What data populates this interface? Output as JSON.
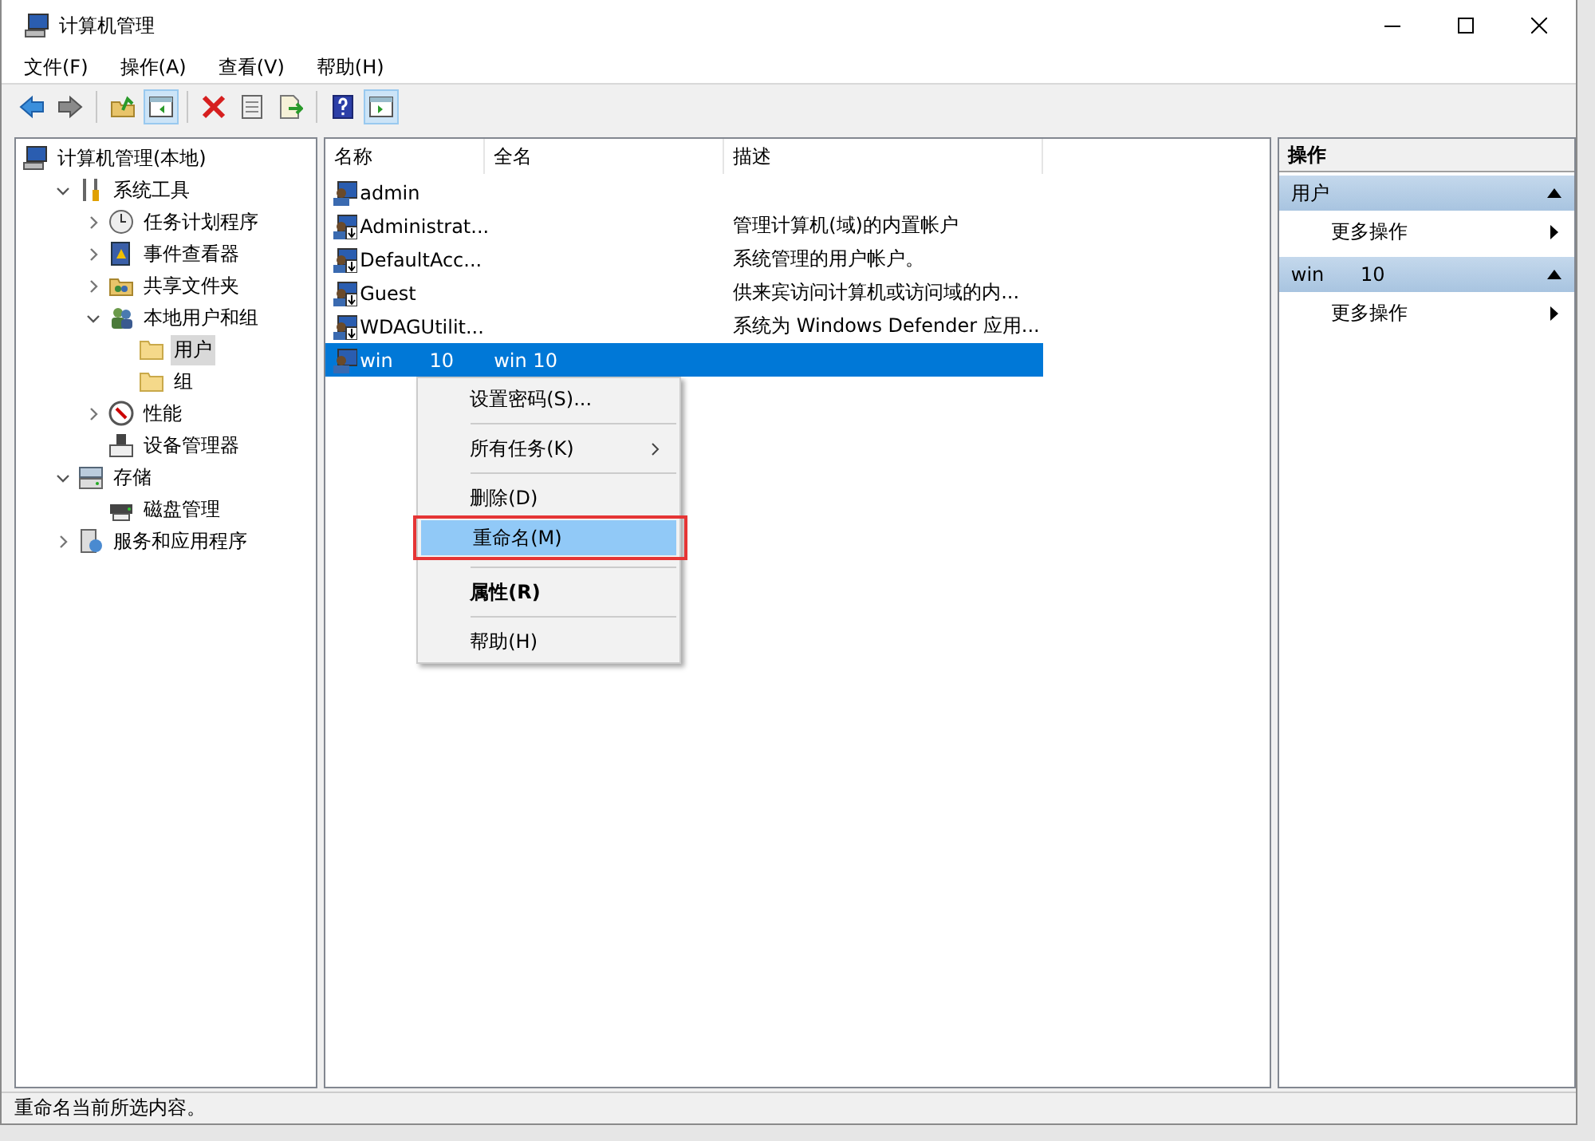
{
  "window": {
    "title": "计算机管理"
  },
  "menu_bar": [
    "文件(F)",
    "操作(A)",
    "查看(V)",
    "帮助(H)"
  ],
  "toolbar": [
    {
      "kind": "back",
      "pressed": false
    },
    {
      "kind": "forward",
      "pressed": false
    },
    {
      "kind": "sep"
    },
    {
      "kind": "up",
      "pressed": false
    },
    {
      "kind": "tree",
      "pressed": true
    },
    {
      "kind": "sep"
    },
    {
      "kind": "delete",
      "pressed": false
    },
    {
      "kind": "properties",
      "pressed": false
    },
    {
      "kind": "export",
      "pressed": false
    },
    {
      "kind": "sep"
    },
    {
      "kind": "help",
      "pressed": false
    },
    {
      "kind": "actionpane",
      "pressed": true
    }
  ],
  "tree": [
    {
      "label": "计算机管理(本地)",
      "kind": "computer",
      "selected": false,
      "children": [
        {
          "label": "系统工具",
          "kind": "tools",
          "expanded": true,
          "selected": false,
          "children": [
            {
              "label": "任务计划程序",
              "kind": "clock",
              "expanded": false,
              "selected": false
            },
            {
              "label": "事件查看器",
              "kind": "event",
              "expanded": false,
              "selected": false
            },
            {
              "label": "共享文件夹",
              "kind": "share",
              "expanded": false,
              "selected": false
            },
            {
              "label": "本地用户和组",
              "kind": "users",
              "expanded": true,
              "selected": false,
              "children": [
                {
                  "label": "用户",
                  "kind": "folder",
                  "selected": true
                },
                {
                  "label": "组",
                  "kind": "folder",
                  "selected": false
                }
              ]
            },
            {
              "label": "性能",
              "kind": "perf",
              "expanded": false,
              "selected": false
            },
            {
              "label": "设备管理器",
              "kind": "device",
              "selected": false
            }
          ]
        },
        {
          "label": "存储",
          "kind": "storage",
          "expanded": true,
          "selected": false,
          "children": [
            {
              "label": "磁盘管理",
              "kind": "disk",
              "selected": false
            }
          ]
        },
        {
          "label": "服务和应用程序",
          "kind": "services",
          "expanded": false,
          "selected": false
        }
      ]
    }
  ],
  "table": {
    "columns": [
      "名称",
      "全名",
      "描述"
    ],
    "rows": [
      {
        "name": "admin",
        "full_name": "",
        "description": "",
        "kind": "user",
        "selected": false
      },
      {
        "name": "Administrat...",
        "full_name": "",
        "description": "管理计算机(域)的内置帐户",
        "kind": "disabled-user",
        "selected": false
      },
      {
        "name": "DefaultAcc...",
        "full_name": "",
        "description": "系统管理的用户帐户。",
        "kind": "disabled-user",
        "selected": false
      },
      {
        "name": "Guest",
        "full_name": "",
        "description": "供来宾访问计算机或访问域的内...",
        "kind": "disabled-user",
        "selected": false
      },
      {
        "name": "WDAGUtilit...",
        "full_name": "",
        "description": "系统为 Windows Defender 应用...",
        "kind": "disabled-user",
        "selected": false
      },
      {
        "name": "win      10",
        "full_name": "win 10",
        "description": "",
        "kind": "user",
        "selected": true
      }
    ]
  },
  "context_menu": [
    {
      "kind": "item",
      "label": "设置密码(S)...",
      "submenu": false,
      "bold": false,
      "highlighted": false,
      "annotated": false
    },
    {
      "kind": "separator"
    },
    {
      "kind": "item",
      "label": "所有任务(K)",
      "submenu": true,
      "bold": false,
      "highlighted": false,
      "annotated": false
    },
    {
      "kind": "separator"
    },
    {
      "kind": "item",
      "label": "删除(D)",
      "submenu": false,
      "bold": false,
      "highlighted": false,
      "annotated": false
    },
    {
      "kind": "item",
      "label": "重命名(M)",
      "submenu": false,
      "bold": false,
      "highlighted": true,
      "annotated": true
    },
    {
      "kind": "separator"
    },
    {
      "kind": "item",
      "label": "属性(R)",
      "submenu": false,
      "bold": true,
      "highlighted": false,
      "annotated": false
    },
    {
      "kind": "separator"
    },
    {
      "kind": "item",
      "label": "帮助(H)",
      "submenu": false,
      "bold": false,
      "highlighted": false,
      "annotated": false
    }
  ],
  "actions": {
    "title": "操作",
    "groups": [
      {
        "title": "用户",
        "expanded": true,
        "items": [
          "更多操作"
        ]
      },
      {
        "title": "win      10",
        "expanded": true,
        "items": [
          "更多操作"
        ]
      }
    ]
  },
  "status_bar": "重命名当前所选内容。"
}
